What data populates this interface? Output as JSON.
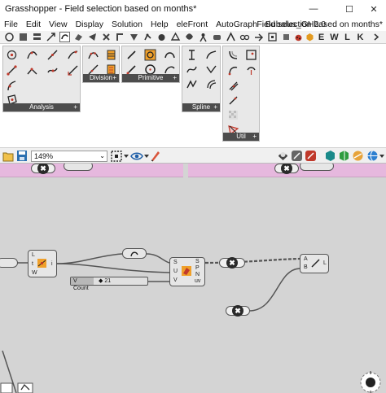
{
  "window": {
    "app_title": "Grasshopper - Field selection based on months*",
    "minimize_glyph": "—",
    "maximize_glyph": "☐",
    "close_glyph": "✕"
  },
  "menu": {
    "items": [
      "File",
      "Edit",
      "View",
      "Display",
      "Solution",
      "Help",
      "eleFront",
      "AutoGraph",
      "Bubalus_GH2.0"
    ],
    "document_title": "Field selection based on months*"
  },
  "tabs": {
    "letters": [
      "E",
      "W",
      "L",
      "K"
    ]
  },
  "ribbon": {
    "panels": [
      {
        "label": "Analysis",
        "plus": "+"
      },
      {
        "label": "Division",
        "plus": "+"
      },
      {
        "label": "Primitive",
        "plus": "+"
      },
      {
        "label": "Spline",
        "plus": "+"
      },
      {
        "label": "Util",
        "plus": "+"
      }
    ]
  },
  "canvas_toolbar": {
    "zoom": "149%",
    "zoom_dropdown": "⌄"
  },
  "canvas": {
    "components": {
      "left": {
        "ports_in": [
          "L",
          "t",
          "W"
        ],
        "ports_out": [
          "i"
        ]
      },
      "mid": {
        "ports_in": [
          "S",
          "U",
          "V"
        ],
        "ports_out": [
          "S",
          "P",
          "N",
          "uv"
        ]
      },
      "right": {
        "ports_in": [
          "A",
          "B"
        ],
        "ports_out": [
          "L"
        ]
      }
    },
    "slider": {
      "label": "V Count",
      "value": "◆ 21"
    },
    "x_glyph": "✖"
  },
  "colors": {
    "group_fill": "#e6b8de",
    "canvas_bg": "#d4d4d4",
    "panel_bg": "#e8e8e8",
    "panel_label_bg": "#4c4c4c"
  }
}
